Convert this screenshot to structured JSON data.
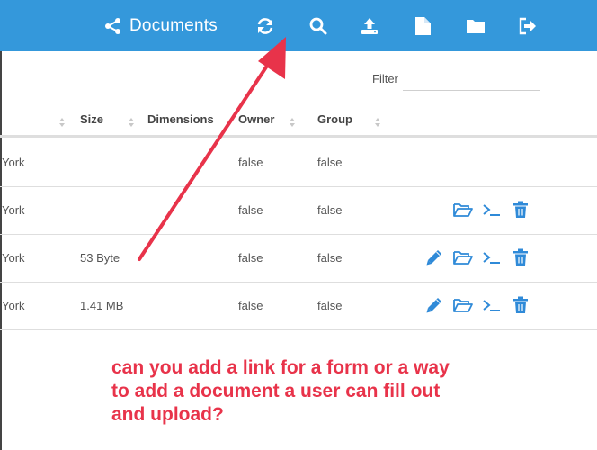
{
  "header": {
    "title": "Documents",
    "icons": [
      "share-icon",
      "refresh-icon",
      "search-icon",
      "upload-icon",
      "new-file-icon",
      "new-folder-icon",
      "logout-icon"
    ]
  },
  "filter": {
    "label": "Filter",
    "value": ""
  },
  "table": {
    "columns": [
      "Size",
      "Dimensions",
      "Owner",
      "Group"
    ],
    "rows": [
      {
        "name": "York",
        "size": "",
        "dimensions": "",
        "owner": "false",
        "group": "false",
        "actions": []
      },
      {
        "name": "York",
        "size": "",
        "dimensions": "",
        "owner": "false",
        "group": "false",
        "actions": [
          "open-folder-icon",
          "terminal-icon",
          "trash-icon"
        ]
      },
      {
        "name": "York",
        "size": "53 Byte",
        "dimensions": "",
        "owner": "false",
        "group": "false",
        "actions": [
          "edit-icon",
          "open-folder-icon",
          "terminal-icon",
          "trash-icon"
        ]
      },
      {
        "name": "York",
        "size": "1.41 MB",
        "dimensions": "",
        "owner": "false",
        "group": "false",
        "actions": [
          "edit-icon",
          "open-folder-icon",
          "terminal-icon",
          "trash-icon"
        ]
      }
    ]
  },
  "annotation": {
    "lines": [
      "can you add a link for a form or a way",
      "to add a document a user can fill out",
      "and upload?"
    ]
  },
  "colors": {
    "topbar": "#3498db",
    "action_icons": "#2f8ad8",
    "annotation": "#e8334a",
    "text": "#555555"
  }
}
